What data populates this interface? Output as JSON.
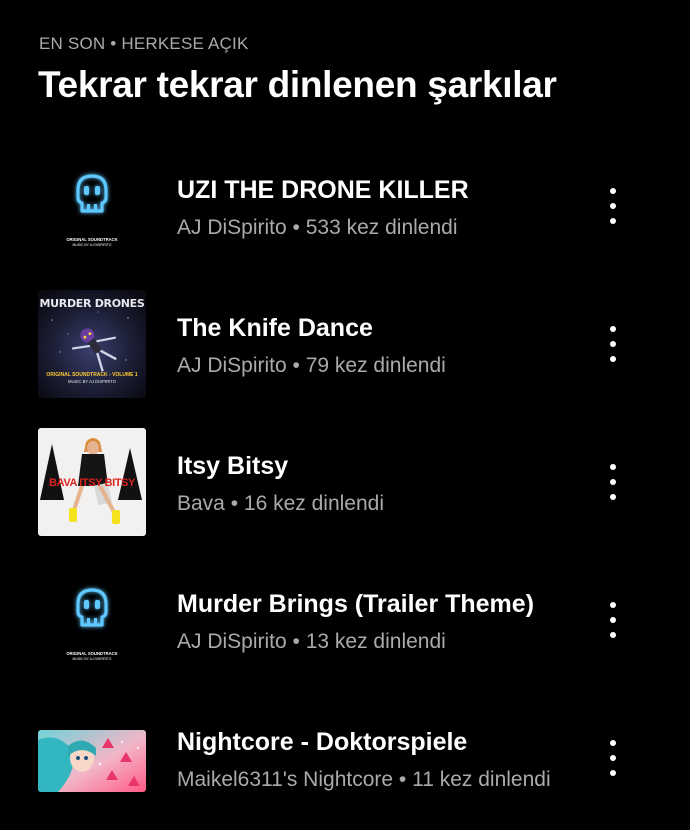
{
  "header": {
    "eyebrow": "EN SON • HERKESE AÇIK",
    "title": "Tekrar tekrar dinlenen şarkılar"
  },
  "songs": [
    {
      "title": "UZI THE DRONE KILLER",
      "meta": "AJ DiSpirito • 533 kez dinlendi",
      "art_caption_line1": "ORIGINAL SOUNDTRACK",
      "art_caption_line2": "MUSIC BY AJ DISPIRITO"
    },
    {
      "title": "The Knife Dance",
      "meta": "AJ DiSpirito • 79 kez dinlendi",
      "art_title": "MURDER DRONES",
      "art_caption_line1": "ORIGINAL SOUNDTRACK - VOLUME 1",
      "art_caption_line2": "MUSIC BY AJ DISPIRITO"
    },
    {
      "title": "Itsy Bitsy",
      "meta": "Bava • 16 kez dinlendi",
      "art_title": "BAVA   ITSY BITSY"
    },
    {
      "title": "Murder Brings (Trailer Theme)",
      "meta": "AJ DiSpirito • 13 kez dinlendi",
      "art_caption_line1": "ORIGINAL SOUNDTRACK",
      "art_caption_line2": "MUSIC BY AJ DISPIRITO"
    },
    {
      "title": "Nightcore - Doktorspiele",
      "meta": "Maikel6311's Nightcore • 11 kez dinlendi"
    }
  ],
  "colors": {
    "background": "#000000",
    "primary_text": "#ffffff",
    "secondary_text": "#aaaaaa",
    "skull_glow": "#5ec8ff"
  },
  "icons": {
    "more": "more-vertical-icon"
  }
}
